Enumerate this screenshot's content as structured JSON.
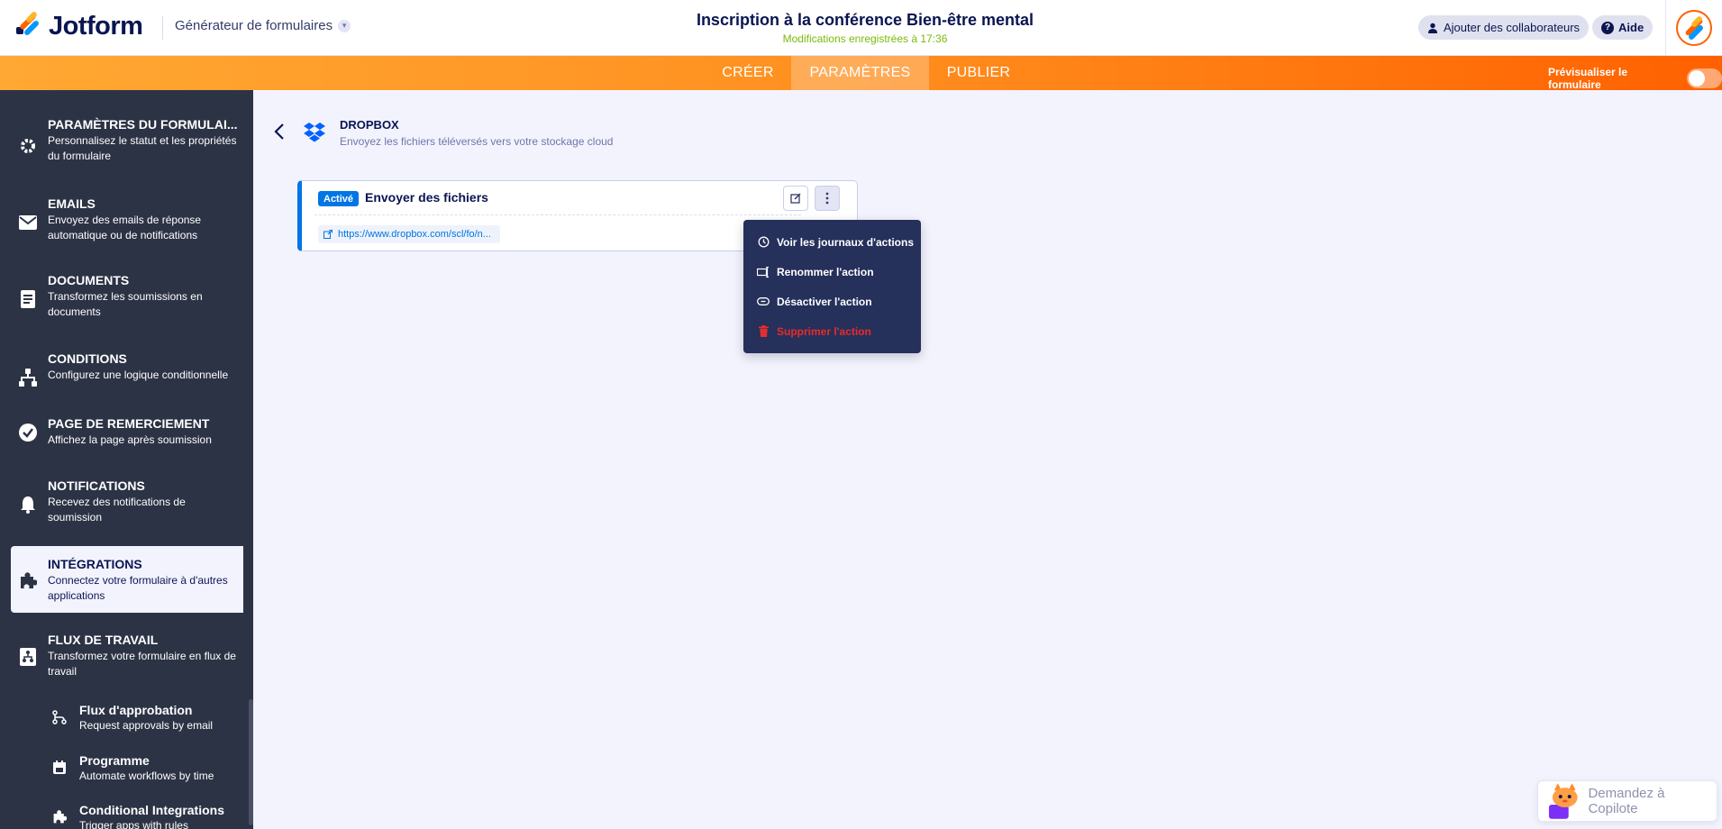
{
  "header": {
    "logo_text": "Jotform",
    "builder_label": "Générateur de formulaires",
    "form_title": "Inscription à la conférence Bien-être mental",
    "save_status": "Modifications enregistrées à 17:36",
    "collab_label": "Ajouter des collaborateurs",
    "help_label": "Aide"
  },
  "nav": {
    "tabs": [
      "CRÉER",
      "PARAMÈTRES",
      "PUBLIER"
    ],
    "active": "PARAMÈTRES",
    "preview_label": "Prévisualiser le formulaire"
  },
  "sidebar": {
    "items": [
      {
        "title": "PARAMÈTRES DU FORMULAI...",
        "desc": "Personnalisez le statut et les propriétés du formulaire",
        "icon": "gear-icon"
      },
      {
        "title": "EMAILS",
        "desc": "Envoyez des emails de réponse automatique ou de notifications",
        "icon": "envelope-icon"
      },
      {
        "title": "DOCUMENTS",
        "desc": "Transformez les soumissions en documents",
        "icon": "document-icon"
      },
      {
        "title": "CONDITIONS",
        "desc": "Configurez une logique conditionnelle",
        "icon": "sitemap-icon"
      },
      {
        "title": "PAGE DE REMERCIEMENT",
        "desc": "Affichez la page après soumission",
        "icon": "check-circle-icon"
      },
      {
        "title": "NOTIFICATIONS",
        "desc": "Recevez des notifications de soumission",
        "icon": "bell-icon"
      },
      {
        "title": "INTÉGRATIONS",
        "desc": "Connectez votre formulaire à d'autres applications",
        "icon": "puzzle-icon"
      },
      {
        "title": "FLUX DE TRAVAIL",
        "desc": "Transformez votre formulaire en flux de travail",
        "icon": "workflow-icon"
      }
    ],
    "sub_items": [
      {
        "title": "Flux d'approbation",
        "desc": "Request approvals by email",
        "icon": "approval-flow-icon"
      },
      {
        "title": "Programme",
        "desc": "Automate workflows by time",
        "icon": "calendar-icon"
      },
      {
        "title": "Conditional Integrations",
        "desc": "Trigger apps with rules",
        "icon": "puzzle-icon"
      }
    ]
  },
  "integration": {
    "name": "DROPBOX",
    "description": "Envoyez les fichiers téléversés vers votre stockage cloud"
  },
  "action": {
    "status_badge": "Activé",
    "title": "Envoyer des fichiers",
    "url": "https://www.dropbox.com/scl/fo/n..."
  },
  "menu": {
    "items": [
      {
        "label": "Voir les journaux d'actions",
        "icon": "history-icon"
      },
      {
        "label": "Renommer l'action",
        "icon": "rename-icon"
      },
      {
        "label": "Désactiver l'action",
        "icon": "link-icon"
      },
      {
        "label": "Supprimer l'action",
        "icon": "trash-icon",
        "danger": true
      }
    ]
  },
  "copilot": {
    "label": "Demandez à Copilote"
  },
  "colors": {
    "accent_orange": "#ff6100",
    "sidebar_bg": "#2c3345",
    "active_blue": "#0075e3",
    "danger_red": "#e62c2c",
    "saved_green": "#78bb07"
  }
}
